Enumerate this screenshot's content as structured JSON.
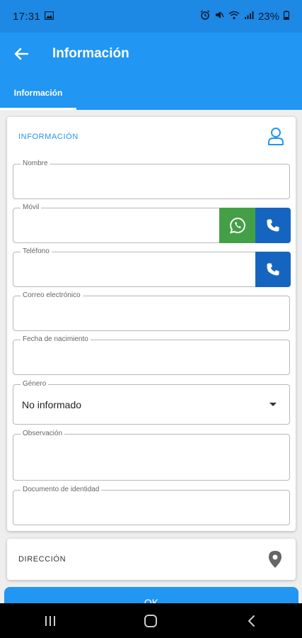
{
  "status_bar": {
    "time": "17:31",
    "battery": "23%",
    "icons": [
      "gallery-icon",
      "alarm-icon",
      "mute-icon",
      "wifi-icon",
      "signal-icon",
      "battery-icon"
    ]
  },
  "app_bar": {
    "title": "Información",
    "back_icon": "arrow-left-icon"
  },
  "tabs": [
    {
      "label": "Información",
      "selected": true
    }
  ],
  "info_card": {
    "header": "INFORMACIÓN",
    "header_icon": "person-icon",
    "fields": {
      "nombre": {
        "label": "Nombre",
        "value": ""
      },
      "movil": {
        "label": "Móvil",
        "value": ""
      },
      "telefono": {
        "label": "Teléfono",
        "value": ""
      },
      "correo": {
        "label": "Correo electrónico",
        "value": ""
      },
      "fecha": {
        "label": "Fecha de nacimiento",
        "value": ""
      },
      "genero": {
        "label": "Género",
        "value": "No informado"
      },
      "observacion": {
        "label": "Observación",
        "value": ""
      },
      "documento": {
        "label": "Documento de identidad",
        "value": ""
      }
    }
  },
  "direccion_card": {
    "title": "DIRECCIÓN",
    "icon": "location-pin-icon"
  },
  "ok_button": {
    "label": "OK"
  },
  "nav_bar": {
    "items": [
      "recents-icon",
      "home-icon",
      "back-icon"
    ]
  },
  "colors": {
    "primary": "#2196f3",
    "status_bar": "#1e88e5",
    "whatsapp": "#43a047",
    "call": "#1565c0"
  }
}
